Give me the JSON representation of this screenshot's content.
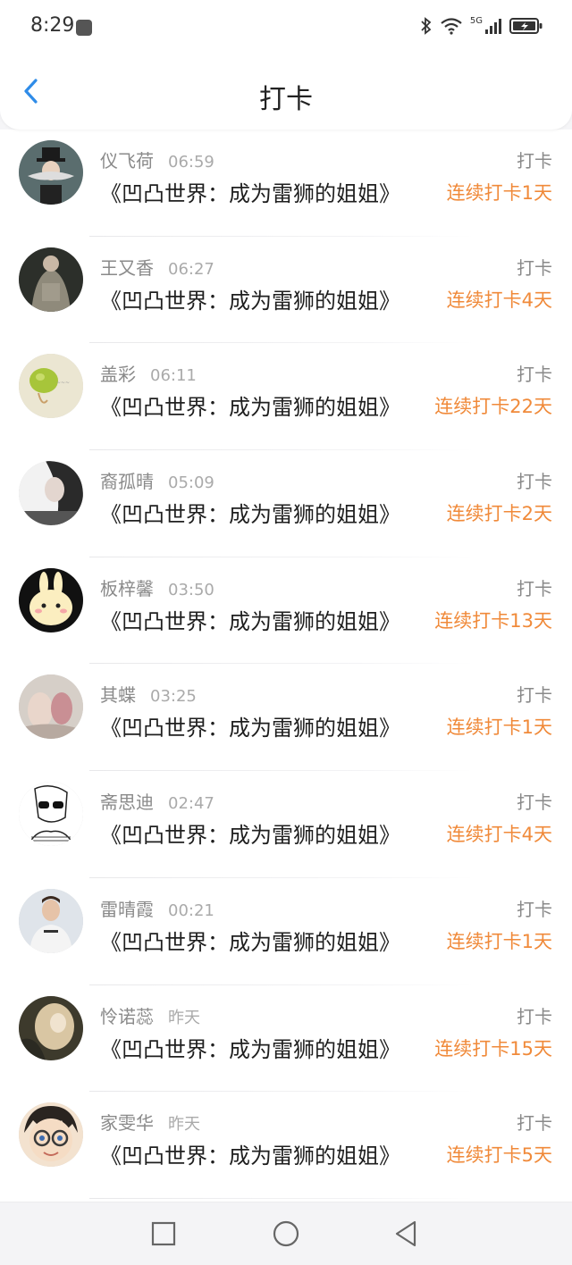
{
  "status": {
    "time": "8:29",
    "network": "5G"
  },
  "header": {
    "title": "打卡"
  },
  "colors": {
    "accent": "#2f8ce8",
    "streak": "#f08a3a"
  },
  "entries": [
    {
      "name": "仪飞荷",
      "time": "06:59",
      "book": "《凹凸世界：成为雷狮的姐姐》",
      "type": "打卡",
      "streak": "连续打卡1天"
    },
    {
      "name": "王又香",
      "time": "06:27",
      "book": "《凹凸世界：成为雷狮的姐姐》",
      "type": "打卡",
      "streak": "连续打卡4天"
    },
    {
      "name": "盖彩",
      "time": "06:11",
      "book": "《凹凸世界：成为雷狮的姐姐》",
      "type": "打卡",
      "streak": "连续打卡22天"
    },
    {
      "name": "裔孤晴",
      "time": "05:09",
      "book": "《凹凸世界：成为雷狮的姐姐》",
      "type": "打卡",
      "streak": "连续打卡2天"
    },
    {
      "name": "板梓馨",
      "time": "03:50",
      "book": "《凹凸世界：成为雷狮的姐姐》",
      "type": "打卡",
      "streak": "连续打卡13天"
    },
    {
      "name": "其蝶",
      "time": "03:25",
      "book": "《凹凸世界：成为雷狮的姐姐》",
      "type": "打卡",
      "streak": "连续打卡1天"
    },
    {
      "name": "斋思迪",
      "time": "02:47",
      "book": "《凹凸世界：成为雷狮的姐姐》",
      "type": "打卡",
      "streak": "连续打卡4天"
    },
    {
      "name": "雷晴霞",
      "time": "00:21",
      "book": "《凹凸世界：成为雷狮的姐姐》",
      "type": "打卡",
      "streak": "连续打卡1天"
    },
    {
      "name": "怜诺蕊",
      "time": "昨天",
      "book": "《凹凸世界：成为雷狮的姐姐》",
      "type": "打卡",
      "streak": "连续打卡15天"
    },
    {
      "name": "家雯华",
      "time": "昨天",
      "book": "《凹凸世界：成为雷狮的姐姐》",
      "type": "打卡",
      "streak": "连续打卡5天"
    }
  ],
  "nav": {
    "icons": [
      "square-icon",
      "circle-icon",
      "triangle-back-icon"
    ]
  }
}
